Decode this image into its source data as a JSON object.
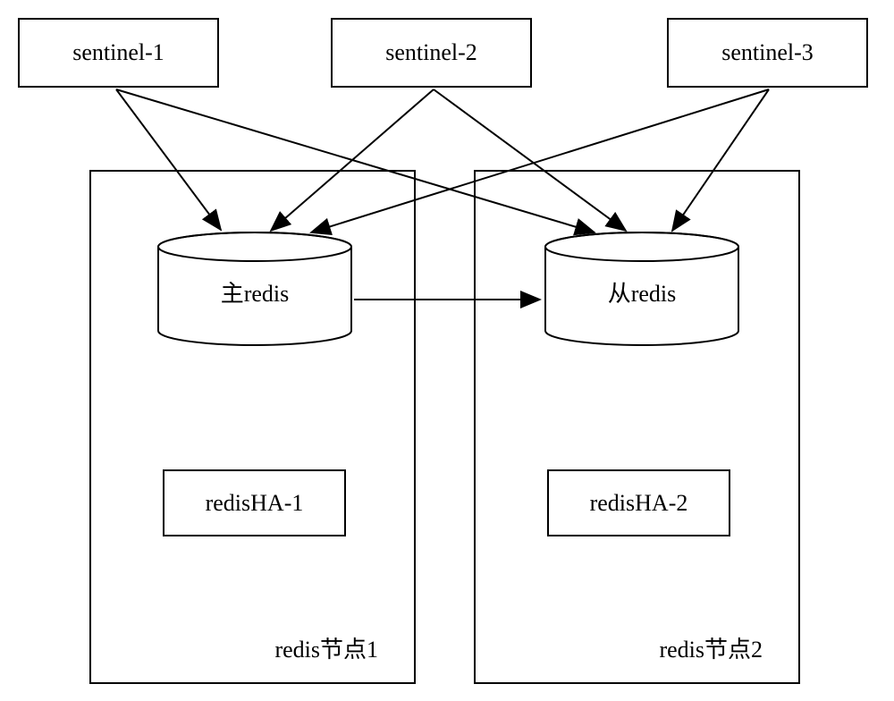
{
  "sentinels": [
    {
      "label": "sentinel-1"
    },
    {
      "label": "sentinel-2"
    },
    {
      "label": "sentinel-3"
    }
  ],
  "nodes": [
    {
      "title": "redis节点1",
      "redis_label": "主redis",
      "ha_label": "redisHA-1"
    },
    {
      "title": "redis节点2",
      "redis_label": "从redis",
      "ha_label": "redisHA-2"
    }
  ]
}
